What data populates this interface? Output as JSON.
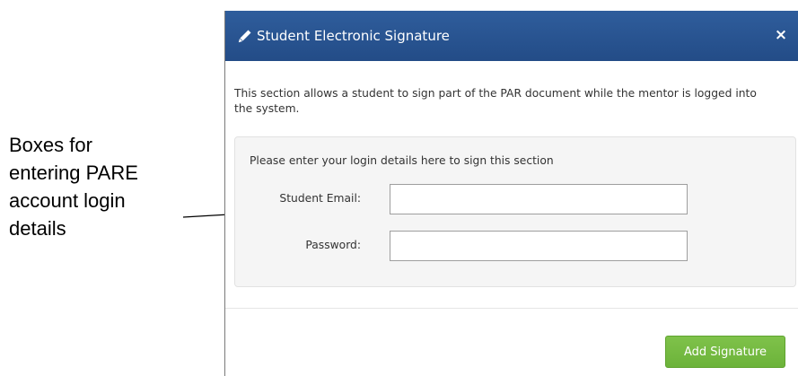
{
  "annotation": {
    "lines": [
      "Boxes for",
      "entering PARE",
      "account login",
      "details"
    ]
  },
  "modal": {
    "title": "Student Electronic Signature",
    "close_label": "×",
    "description": "This section allows a student to sign part of the PAR document while the mentor is logged into the system.",
    "panel": {
      "instruction": "Please enter your login details here to sign this section",
      "email_label": "Student Email:",
      "email_value": "",
      "password_label": "Password:",
      "password_value": ""
    },
    "footer": {
      "add_signature_label": "Add Signature"
    }
  },
  "icons": {
    "title_icon": "pencil-icon",
    "close_icon": "close-icon",
    "annotation_arrow": "arrow-right-icon"
  },
  "colors": {
    "header_blue": "#2f5d9c",
    "button_green": "#75bb43",
    "panel_bg": "#f5f5f5"
  }
}
